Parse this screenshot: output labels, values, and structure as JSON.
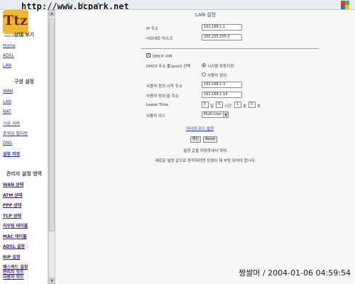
{
  "url_overlay": "http://www.bcpark.net",
  "logo": {
    "text": "Ttz",
    "sub": "www.ettz.com"
  },
  "sidebar": {
    "sections": [
      {
        "title": "상태 보기"
      },
      {
        "title": "구성 설정"
      },
      {
        "title": "관리자 설정 영역"
      }
    ],
    "status_items": [
      "Home",
      "ADSL",
      "LAN"
    ],
    "config_items": [
      "WAN",
      "LAN",
      "NAT",
      "가상 서버",
      "포워딩 필터링",
      "DNS",
      "설정 저장"
    ],
    "admin_items": [
      "WAN 상태",
      "ATM 상태",
      "PPP 상태",
      "TCP 상태",
      "라우팅 테이블",
      "MAC 테이블",
      "ADSL 설정",
      "RIP 설정",
      "패스워드 설정",
      "관리자 모드",
      "사용자 모드"
    ]
  },
  "main": {
    "title": "LAN 설정",
    "ip_label": "IP 주소",
    "ip_value": "192.168.1.1",
    "subnet_label": "서브네트 마스크",
    "subnet_value": "255.255.255.0",
    "dhcp_label": "DHCP 서버",
    "dhcp_checked": true,
    "pool_label": "DHCP 주소 풀(pool) 선택",
    "pool_opt_auto": "시스템 자동지정",
    "pool_opt_user": "사용자 정의",
    "pool_selected": "auto",
    "start_label": "사용자 정의 시작 주소",
    "start_value": "192.168.1.3",
    "end_label": "사용자 정의 끝 주소",
    "end_value": "192.168.1.14",
    "lease_label": "Lease Time",
    "lease_day_value": "0",
    "lease_day_unit": "일",
    "lease_hour_value": "0",
    "lease_hour_unit": "시간",
    "lease_min_value": "1",
    "lease_min_unit": "분",
    "lease_sec_value": "0",
    "lease_sec_unit": "초",
    "user_mode_label": "사용자 모드",
    "user_mode_value": "Multi-User",
    "ethernet_mode_link": "이더넷 모드 설정",
    "confirm_button": "확인",
    "reset_button": "Reset",
    "note1": "설정 값을 저장하세서 하며.",
    "note2": "새로운 설정 값으로 동작하려면 모뎀이 재 부팅 되어야 합니다."
  },
  "watermark": "짱쌀머 / 2004-01-06 04:59:54"
}
